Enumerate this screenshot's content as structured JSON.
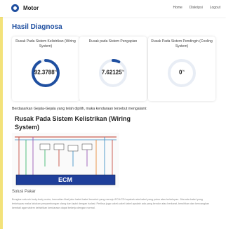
{
  "navbar": {
    "brand": "Motor",
    "links": [
      "Home",
      "Diskripsi",
      "Logout"
    ]
  },
  "page": {
    "title": "Hasil Diagnosa"
  },
  "cards": [
    {
      "title": "Rusak Pada Sistem Kelistrikan (Wiring System)",
      "value": "92.3788",
      "unit": "%",
      "fraction": 0.923788
    },
    {
      "title": "Rusak pada Sistem Pengapian",
      "value": "7.62125",
      "unit": "%",
      "fraction": 0.0762125
    },
    {
      "title": "Rusak Pada Sistem Pendingin (Cooling System)",
      "value": "0",
      "unit": "%",
      "fraction": 0
    }
  ],
  "result": {
    "sentence": "Berdasarkan Gejala-Gejala yang telah dipilih, maka kendaraan tersebut mengalami:",
    "damage_title": "Rusak Pada Sistem Kelistrikan (Wiring System)"
  },
  "diagram": {
    "center_label": "ECM"
  },
  "solusi": {
    "label": "Solusi Pakar",
    "text": "Bongkar seluruh body-body motor, kemudian lihat jalur kabel-kabel tersebut yang menuju ECU/CDI apakah ada kabel yang putus atau terkelupas. Jika ada kabel yang terkelupas maka lakukan penyambungan ulang dan lapisi dengan isolasi. Periksa juga soket-soket kabel apakah ada yang kendor atau berkarat, bersihkan dan kencangkan kembali agar sistem kelistrikan kendaraan dapat bekerja dengan normal."
  },
  "colors": {
    "accent": "#1f4fa0",
    "gauge_track": "#e8edf5",
    "strip": "#f3e27a"
  }
}
